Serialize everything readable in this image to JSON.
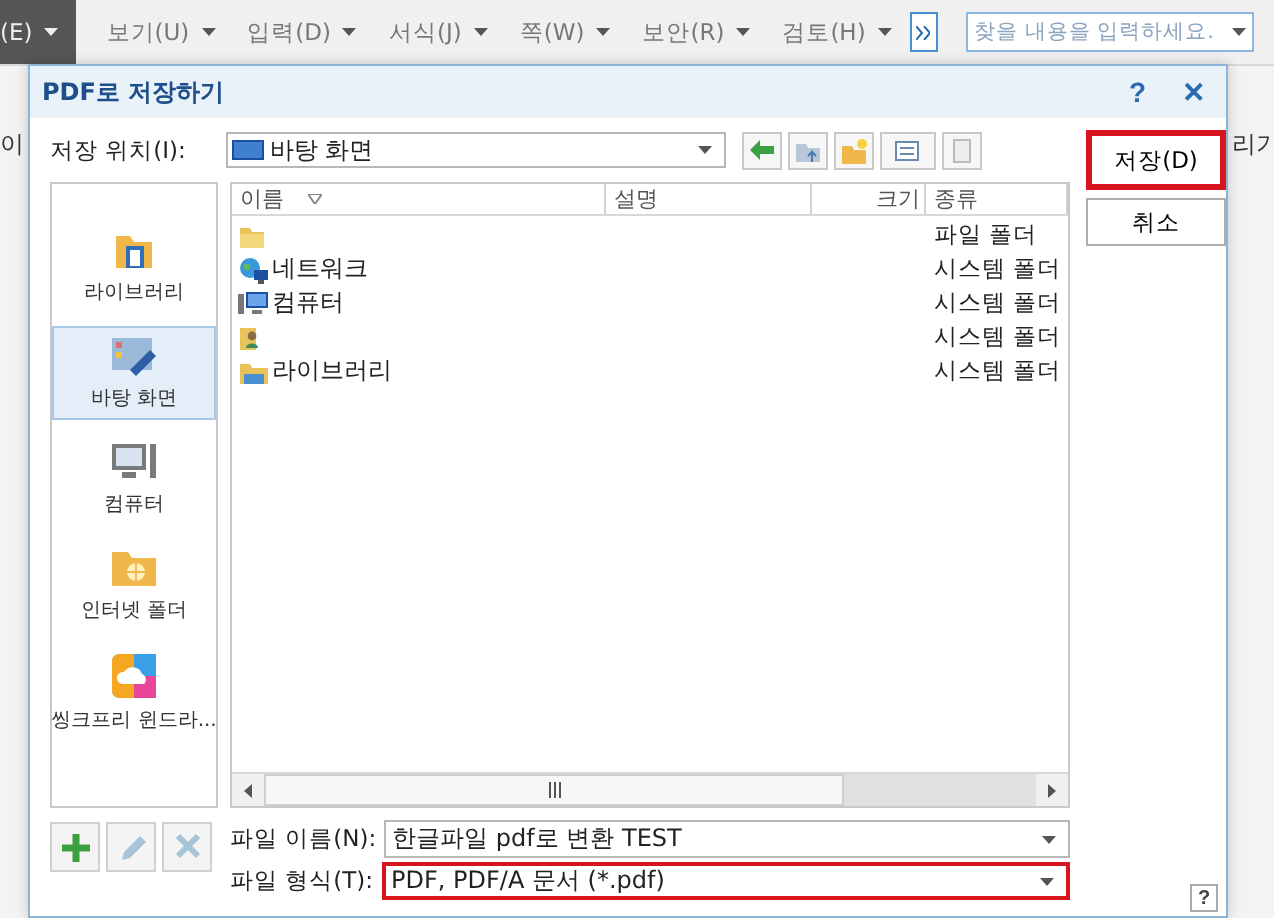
{
  "app": {
    "menu": [
      {
        "label": "(E)",
        "selected": true
      },
      {
        "label": "보기(U)",
        "selected": false
      },
      {
        "label": "입력(D)",
        "selected": false
      },
      {
        "label": "서식(J)",
        "selected": false
      },
      {
        "label": "쪽(W)",
        "selected": false
      },
      {
        "label": "보안(R)",
        "selected": false
      },
      {
        "label": "검토(H)",
        "selected": false
      }
    ],
    "search": {
      "placeholder": "찾을 내용을 입력하세요."
    },
    "left_edge_text": "이",
    "right_edge_text": "리기"
  },
  "dialog": {
    "title": "PDF로 저장하기",
    "help": "?",
    "close": "✕",
    "location": {
      "label": "저장 위치(I):",
      "value": "바탕 화면"
    },
    "buttons": [
      {
        "label": "저장(D)",
        "highlighted": true
      },
      {
        "label": "취소",
        "highlighted": false
      }
    ],
    "places": [
      {
        "label": "라이브러리",
        "kind": "library",
        "selected": false
      },
      {
        "label": "바탕 화면",
        "kind": "desktop",
        "selected": true
      },
      {
        "label": "컴퓨터",
        "kind": "computer",
        "selected": false
      },
      {
        "label": "인터넷 폴더",
        "kind": "internet",
        "selected": false
      },
      {
        "label": "씽크프리 윈드라...",
        "kind": "cloud",
        "selected": false
      }
    ],
    "columns": [
      "이름",
      "설명",
      "크기",
      "종류"
    ],
    "rows": [
      {
        "kind": "folder",
        "type": "파일 폴더"
      },
      {
        "kind": "network",
        "name": "네트워크",
        "type": "시스템 폴더"
      },
      {
        "kind": "computer",
        "name": "컴퓨터",
        "type": "시스템 폴더"
      },
      {
        "kind": "user",
        "type": "시스템 폴더"
      },
      {
        "kind": "library",
        "name": "라이브러리",
        "type": "시스템 폴더"
      }
    ],
    "filename": {
      "label": "파일 이름(N):",
      "value": "한글파일 pdf로 변환 TEST",
      "highlighted": false
    },
    "filetype": {
      "label": "파일 형식(T):",
      "value": "PDF, PDF/A 문서 (*.pdf)",
      "highlighted": true
    },
    "bottom_help": "?"
  }
}
